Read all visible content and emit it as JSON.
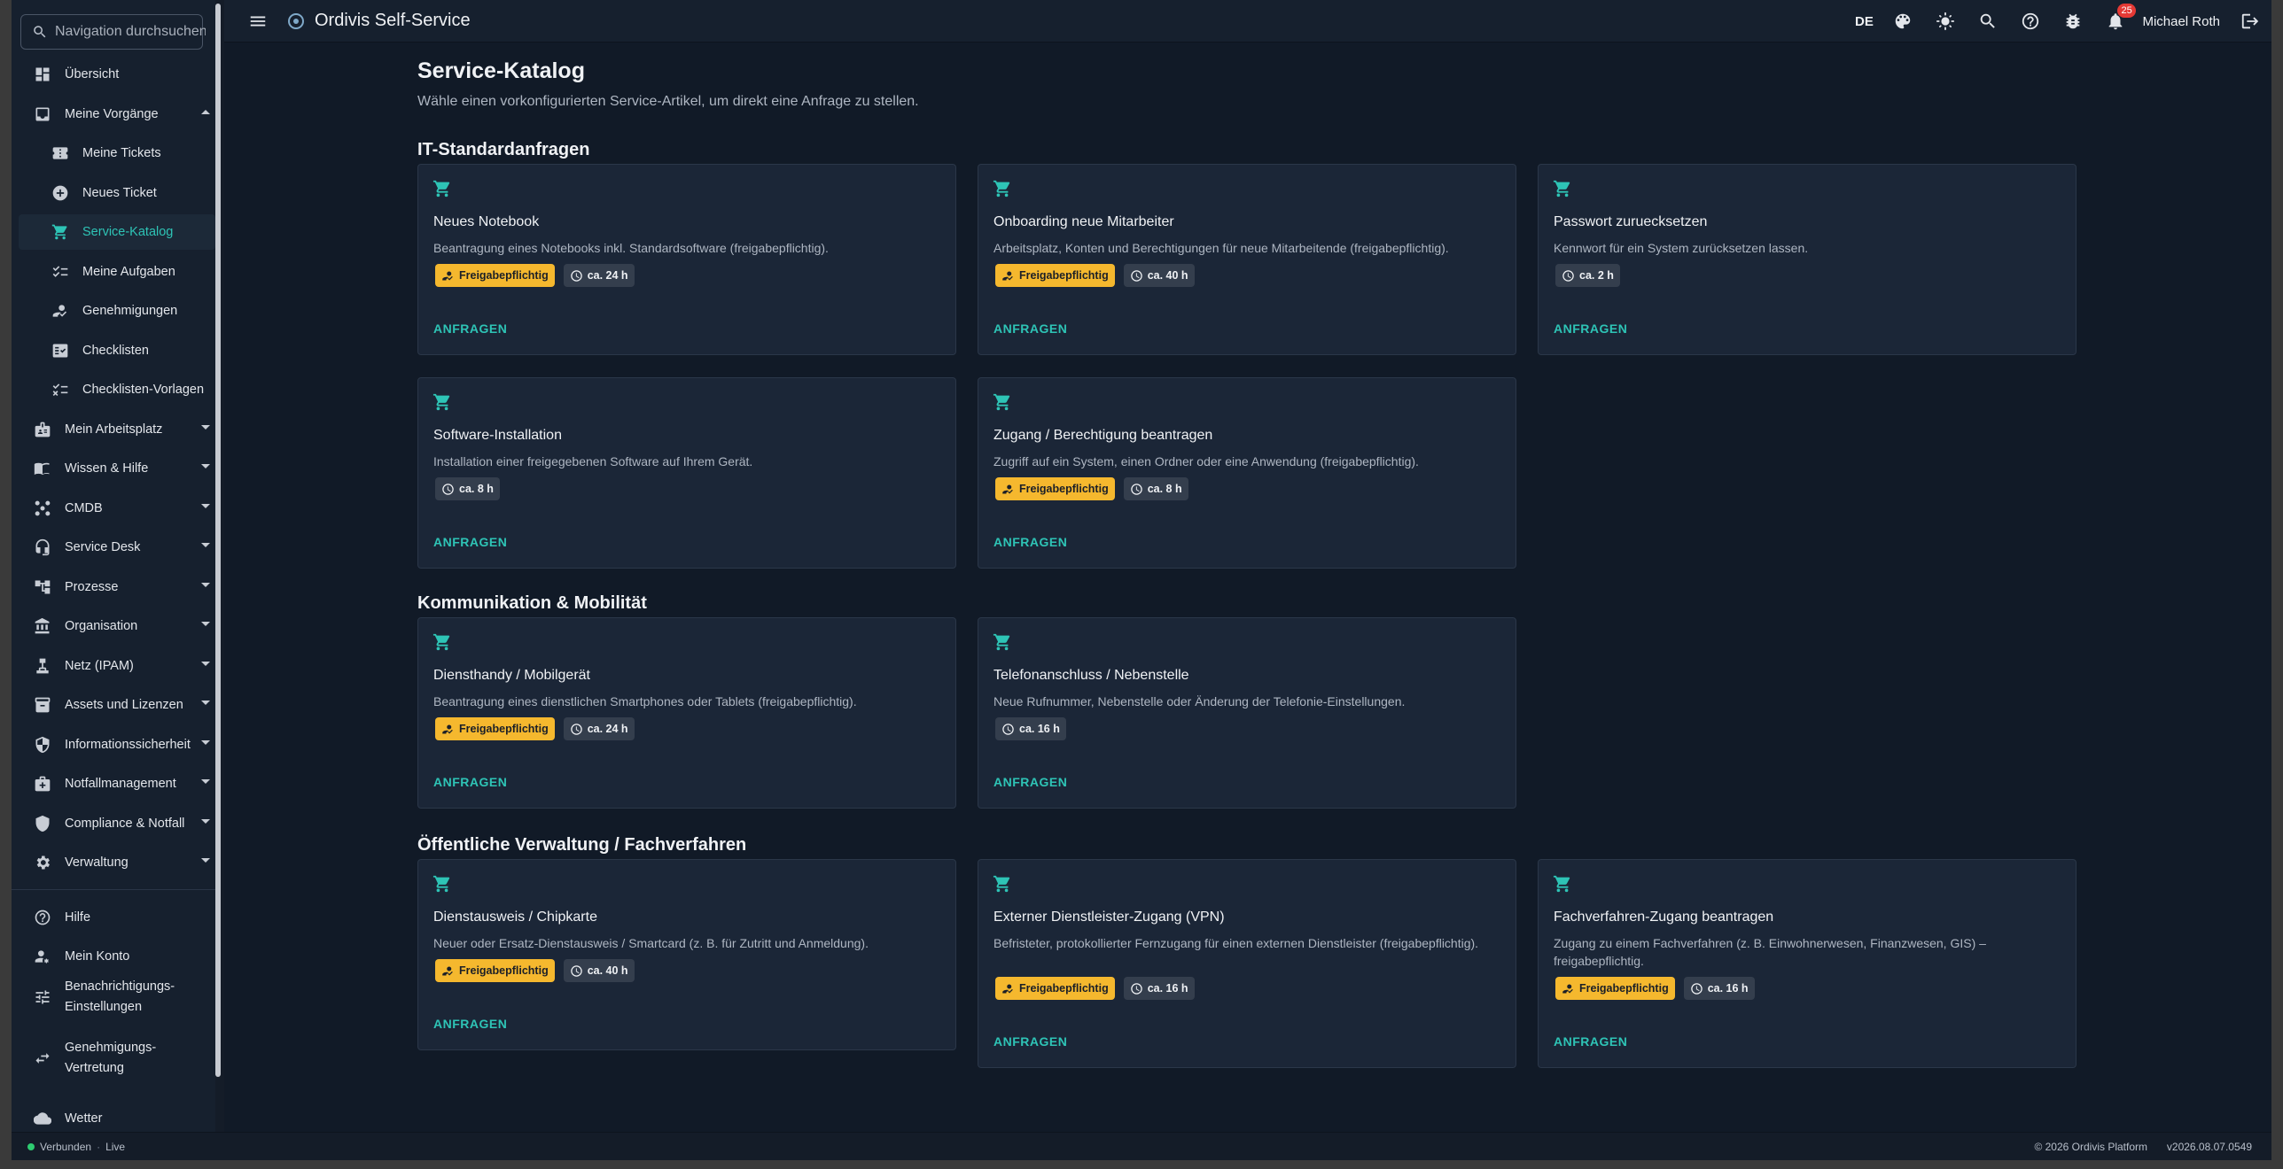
{
  "app": {
    "title": "Ordivis Self-Service"
  },
  "search": {
    "placeholder": "Navigation durchsuchen"
  },
  "sidebar": {
    "items": [
      {
        "label": "Übersicht",
        "icon": "dashboard-icon"
      },
      {
        "label": "Meine Vorgänge",
        "icon": "inbox-icon",
        "expanded": true
      },
      {
        "label": "Meine Tickets",
        "icon": "ticket-icon",
        "sub": true
      },
      {
        "label": "Neues Ticket",
        "icon": "add-circle-icon",
        "sub": true
      },
      {
        "label": "Service-Katalog",
        "icon": "cart-icon",
        "sub": true,
        "active": true
      },
      {
        "label": "Meine Aufgaben",
        "icon": "checklist-icon",
        "sub": true
      },
      {
        "label": "Genehmigungen",
        "icon": "approval-icon",
        "sub": true
      },
      {
        "label": "Checklisten",
        "icon": "fact-check-icon",
        "sub": true
      },
      {
        "label": "Checklisten-Vorlagen",
        "icon": "checklist-template-icon",
        "sub": true
      },
      {
        "label": "Mein Arbeitsplatz",
        "icon": "badge-icon"
      },
      {
        "label": "Wissen & Hilfe",
        "icon": "book-icon"
      },
      {
        "label": "CMDB",
        "icon": "hub-icon"
      },
      {
        "label": "Service Desk",
        "icon": "headset-icon"
      },
      {
        "label": "Prozesse",
        "icon": "workflow-icon"
      },
      {
        "label": "Organisation",
        "icon": "institution-icon"
      },
      {
        "label": "Netz (IPAM)",
        "icon": "network-icon"
      },
      {
        "label": "Assets und Lizenzen",
        "icon": "inventory-icon"
      },
      {
        "label": "Informationssicherheit",
        "icon": "security-icon"
      },
      {
        "label": "Notfallmanagement",
        "icon": "medical-kit-icon"
      },
      {
        "label": "Compliance & Notfall",
        "icon": "shield-icon"
      },
      {
        "label": "Verwaltung",
        "icon": "settings-icon"
      }
    ],
    "bottom_items": [
      {
        "label": "Hilfe",
        "icon": "help-icon"
      },
      {
        "label": "Mein Konto",
        "icon": "account-icon"
      },
      {
        "label": "Benachrichtigungs-Einstellungen",
        "line1": "Benachrichtigungs-",
        "line2": "Einstellungen",
        "icon": "tune-icon"
      },
      {
        "label": "Genehmigungs-Vertretung",
        "line1": "Genehmigungs-",
        "line2": "Vertretung",
        "icon": "swap-icon"
      },
      {
        "label": "Wetter",
        "icon": "cloud-icon"
      }
    ]
  },
  "header": {
    "language": "DE",
    "notification_count": "25",
    "user_name": "Michael Roth"
  },
  "page": {
    "title": "Service-Katalog",
    "subtitle": "Wähle einen vorkonfigurierten Service-Artikel, um direkt eine Anfrage zu stellen."
  },
  "sections": [
    {
      "title": "IT-Standardanfragen",
      "cards": [
        {
          "title": "Neues Notebook",
          "desc": "Beantragung eines Notebooks inkl. Standardsoftware (freigabepflichtig).",
          "approval": "Freigabepflichtig",
          "time": "ca. 24 h",
          "action": "ANFRAGEN"
        },
        {
          "title": "Onboarding neue Mitarbeiter",
          "desc": "Arbeitsplatz, Konten und Berechtigungen für neue Mitarbeitende (freigabepflichtig).",
          "approval": "Freigabepflichtig",
          "time": "ca. 40 h",
          "action": "ANFRAGEN"
        },
        {
          "title": "Passwort zuruecksetzen",
          "desc": "Kennwort für ein System zurücksetzen lassen.",
          "approval": "",
          "time": "ca. 2 h",
          "action": "ANFRAGEN"
        },
        {
          "title": "Software-Installation",
          "desc": "Installation einer freigegebenen Software auf Ihrem Gerät.",
          "approval": "",
          "time": "ca. 8 h",
          "action": "ANFRAGEN"
        },
        {
          "title": "Zugang / Berechtigung beantragen",
          "desc": "Zugriff auf ein System, einen Ordner oder eine Anwendung (freigabepflichtig).",
          "approval": "Freigabepflichtig",
          "time": "ca. 8 h",
          "action": "ANFRAGEN"
        }
      ]
    },
    {
      "title": "Kommunikation & Mobilität",
      "cards": [
        {
          "title": "Diensthandy / Mobilgerät",
          "desc": "Beantragung eines dienstlichen Smartphones oder Tablets (freigabepflichtig).",
          "approval": "Freigabepflichtig",
          "time": "ca. 24 h",
          "action": "ANFRAGEN"
        },
        {
          "title": "Telefonanschluss / Nebenstelle",
          "desc": "Neue Rufnummer, Nebenstelle oder Änderung der Telefonie-Einstellungen.",
          "approval": "",
          "time": "ca. 16 h",
          "action": "ANFRAGEN"
        }
      ]
    },
    {
      "title": "Öffentliche Verwaltung / Fachverfahren",
      "cards": [
        {
          "title": "Dienstausweis / Chipkarte",
          "desc": "Neuer oder Ersatz-Dienstausweis / Smartcard (z. B. für Zutritt und Anmeldung).",
          "approval": "Freigabepflichtig",
          "time": "ca. 40 h",
          "action": "ANFRAGEN"
        },
        {
          "title": "Externer Dienstleister-Zugang (VPN)",
          "desc": "Befristeter, protokollierter Fernzugang für einen externen Dienstleister (freigabepflichtig).",
          "approval": "Freigabepflichtig",
          "time": "ca. 16 h",
          "action": "ANFRAGEN"
        },
        {
          "title": "Fachverfahren-Zugang beantragen",
          "desc": "Zugang zu einem Fachverfahren (z. B. Einwohnerwesen, Finanzwesen, GIS) – freigabepflichtig.",
          "approval": "Freigabepflichtig",
          "time": "ca. 16 h",
          "action": "ANFRAGEN"
        }
      ]
    }
  ],
  "footer": {
    "status": "Verbunden",
    "mode": "Live",
    "copyright": "© 2026 Ordivis Platform",
    "version": "v2026.08.07.0549"
  },
  "colors": {
    "accent": "#2ec4b6",
    "warning": "#f5b82e",
    "background": "#111a27",
    "surface": "#1b2637"
  }
}
